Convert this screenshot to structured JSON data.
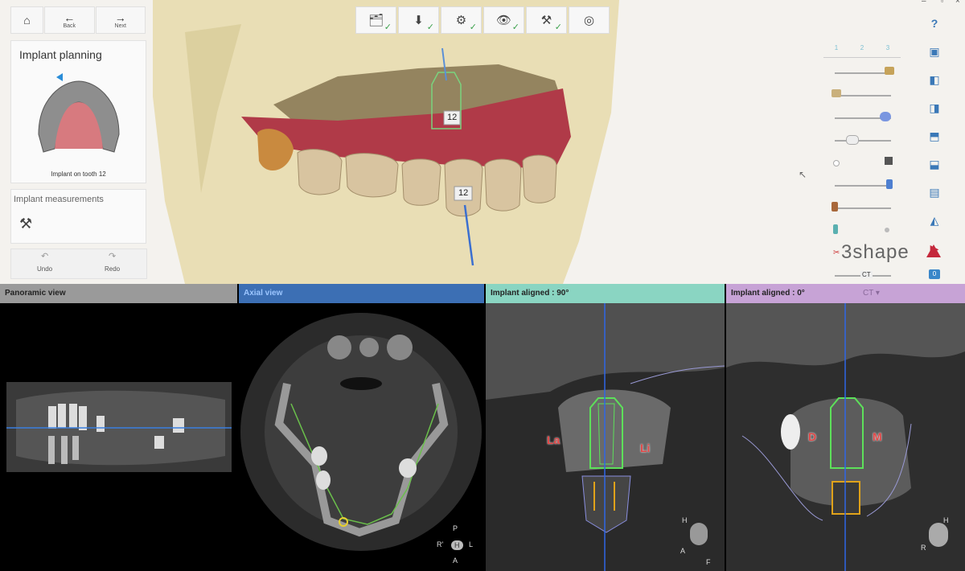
{
  "nav": {
    "home_icon": "home-icon",
    "back_label": "Back",
    "next_label": "Next"
  },
  "panel": {
    "title": "Implant planning",
    "caption": "Implant on tooth 12",
    "measurements_title": "Implant measurements",
    "undo_label": "Undo",
    "redo_label": "Redo"
  },
  "viewport": {
    "implant_tag_top": "12",
    "implant_tag_tooth": "12",
    "brand": "3shape"
  },
  "slider_tabs": [
    "1",
    "2",
    "3"
  ],
  "slider_ct_label": "CT",
  "slider_badge": "0",
  "views": {
    "panoramic": {
      "title": "Panoramic view",
      "color": "#9a9a9a"
    },
    "axial": {
      "title": "Axial view",
      "color": "#3c6fb4"
    },
    "aligned90": {
      "title": "Implant aligned : 90°",
      "color": "#8ad5c2",
      "label_left": "La",
      "label_right": "Li"
    },
    "aligned0": {
      "title": "Implant aligned : 0°",
      "color": "#c7a3d6",
      "label_left": "D",
      "label_right": "M",
      "menu": "CT ▾"
    }
  },
  "orientation": {
    "axial_top": "P",
    "axial_left": "R'",
    "axial_right": "L",
    "axial_bottom": "A",
    "axial_center": "H",
    "a90_top": "H",
    "a90_left": "A",
    "a90_bottom": "F",
    "a0_top": "H",
    "a0_left": "R"
  }
}
